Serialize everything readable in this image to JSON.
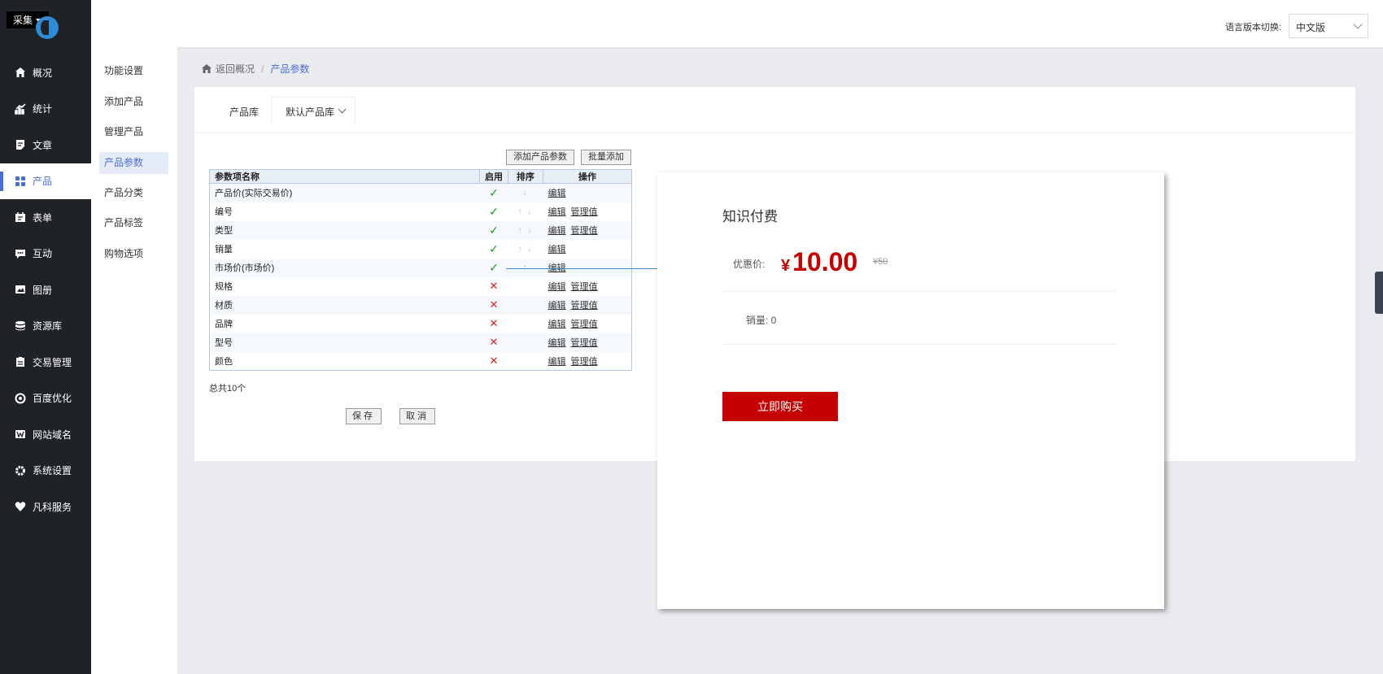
{
  "app": {
    "caiji_label": "采集",
    "brand_color": "#4a6cd4",
    "accent_red": "#c40000"
  },
  "sidebar": {
    "items": [
      {
        "label": "概况",
        "icon": "home-icon"
      },
      {
        "label": "统计",
        "icon": "chart-icon"
      },
      {
        "label": "文章",
        "icon": "document-icon"
      },
      {
        "label": "产品",
        "icon": "grid-icon"
      },
      {
        "label": "表单",
        "icon": "calendar-icon"
      },
      {
        "label": "互动",
        "icon": "chat-icon"
      },
      {
        "label": "图册",
        "icon": "image-icon"
      },
      {
        "label": "资源库",
        "icon": "database-icon"
      },
      {
        "label": "交易管理",
        "icon": "clipboard-icon"
      },
      {
        "label": "百度优化",
        "icon": "refresh-icon"
      },
      {
        "label": "网站域名",
        "icon": "w-icon"
      },
      {
        "label": "系统设置",
        "icon": "gear-icon"
      },
      {
        "label": "凡科服务",
        "icon": "heart-icon"
      }
    ],
    "active_index": 3
  },
  "header": {
    "lang_label": "语言版本切换:",
    "lang_value": "中文版"
  },
  "subnav": {
    "items": [
      "功能设置",
      "添加产品",
      "管理产品",
      "产品参数",
      "产品分类",
      "产品标签",
      "购物选项"
    ],
    "active_index": 3
  },
  "breadcrumb": {
    "back": "返回概况",
    "sep": "/",
    "current": "产品参数"
  },
  "library": {
    "label": "产品库",
    "value": "默认产品库"
  },
  "toolbar": {
    "add_param": "添加产品参数",
    "batch_add": "批量添加"
  },
  "table": {
    "headers": [
      "参数项名称",
      "启用",
      "排序",
      "操作"
    ],
    "edit_label": "编辑",
    "manage_label": "管理值",
    "rows": [
      {
        "name": "产品价(实际交易价)",
        "enabled": "✓",
        "arrows": "↓",
        "manage": false
      },
      {
        "name": "编号",
        "enabled": "✓",
        "arrows": "↑ ↓",
        "manage": true
      },
      {
        "name": "类型",
        "enabled": "✓",
        "arrows": "↑ ↓",
        "manage": true
      },
      {
        "name": "销量",
        "enabled": "✓",
        "arrows": "↑ ↓",
        "manage": false
      },
      {
        "name": "市场价(市场价)",
        "enabled": "✓",
        "arrows": "↑",
        "manage": false
      },
      {
        "name": "规格",
        "enabled": "✕",
        "arrows": "",
        "manage": true
      },
      {
        "name": "材质",
        "enabled": "✕",
        "arrows": "",
        "manage": true
      },
      {
        "name": "品牌",
        "enabled": "✕",
        "arrows": "",
        "manage": true
      },
      {
        "name": "型号",
        "enabled": "✕",
        "arrows": "",
        "manage": true
      },
      {
        "name": "颜色",
        "enabled": "✕",
        "arrows": "",
        "manage": true
      }
    ],
    "total": "总共10个"
  },
  "actions": {
    "save": "保存",
    "cancel": "取消"
  },
  "preview": {
    "title": "知识付费",
    "price_label": "优惠价:",
    "currency": "¥",
    "price": "10.00",
    "old_price": "¥50",
    "sales": "销量: 0",
    "buy": "立即购买"
  }
}
